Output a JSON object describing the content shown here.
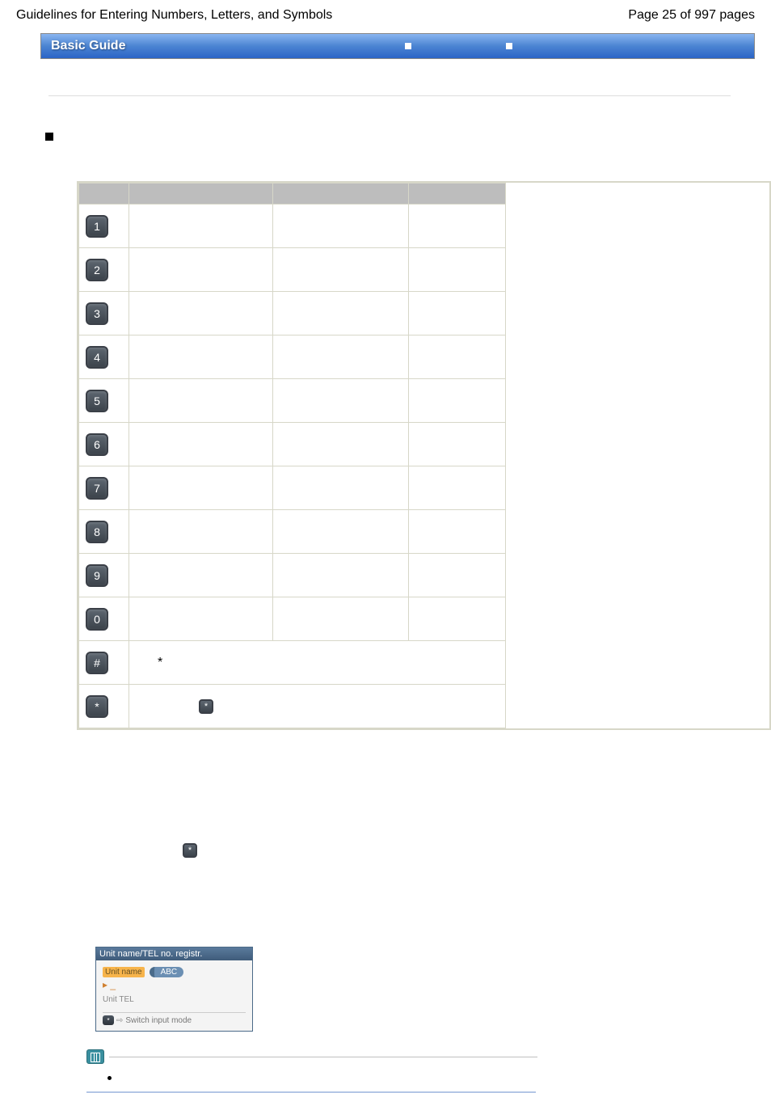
{
  "header": {
    "title": "Guidelines for Entering Numbers, Letters, and Symbols",
    "page_indicator": "Page 25 of 997 pages"
  },
  "blueBar": {
    "label": "Basic Guide"
  },
  "keypad": {
    "rows": [
      {
        "key": "1"
      },
      {
        "key": "2"
      },
      {
        "key": "3"
      },
      {
        "key": "4"
      },
      {
        "key": "5"
      },
      {
        "key": "6"
      },
      {
        "key": "7"
      },
      {
        "key": "8"
      },
      {
        "key": "9"
      },
      {
        "key": "0"
      }
    ],
    "hashRow": {
      "key": "#",
      "colA": "*"
    },
    "starRow": {
      "key": "*",
      "small_key": "*"
    }
  },
  "smallStar": {
    "key": "*"
  },
  "regShot": {
    "top": "Unit name/TEL no. registr.",
    "unit_name_label": "Unit name",
    "abc_label": "ABC",
    "caret": "▸ _",
    "unit_tel_label": "Unit TEL",
    "footer_key": "*",
    "footer_arrow": "⇨",
    "footer_text": "Switch input mode"
  }
}
